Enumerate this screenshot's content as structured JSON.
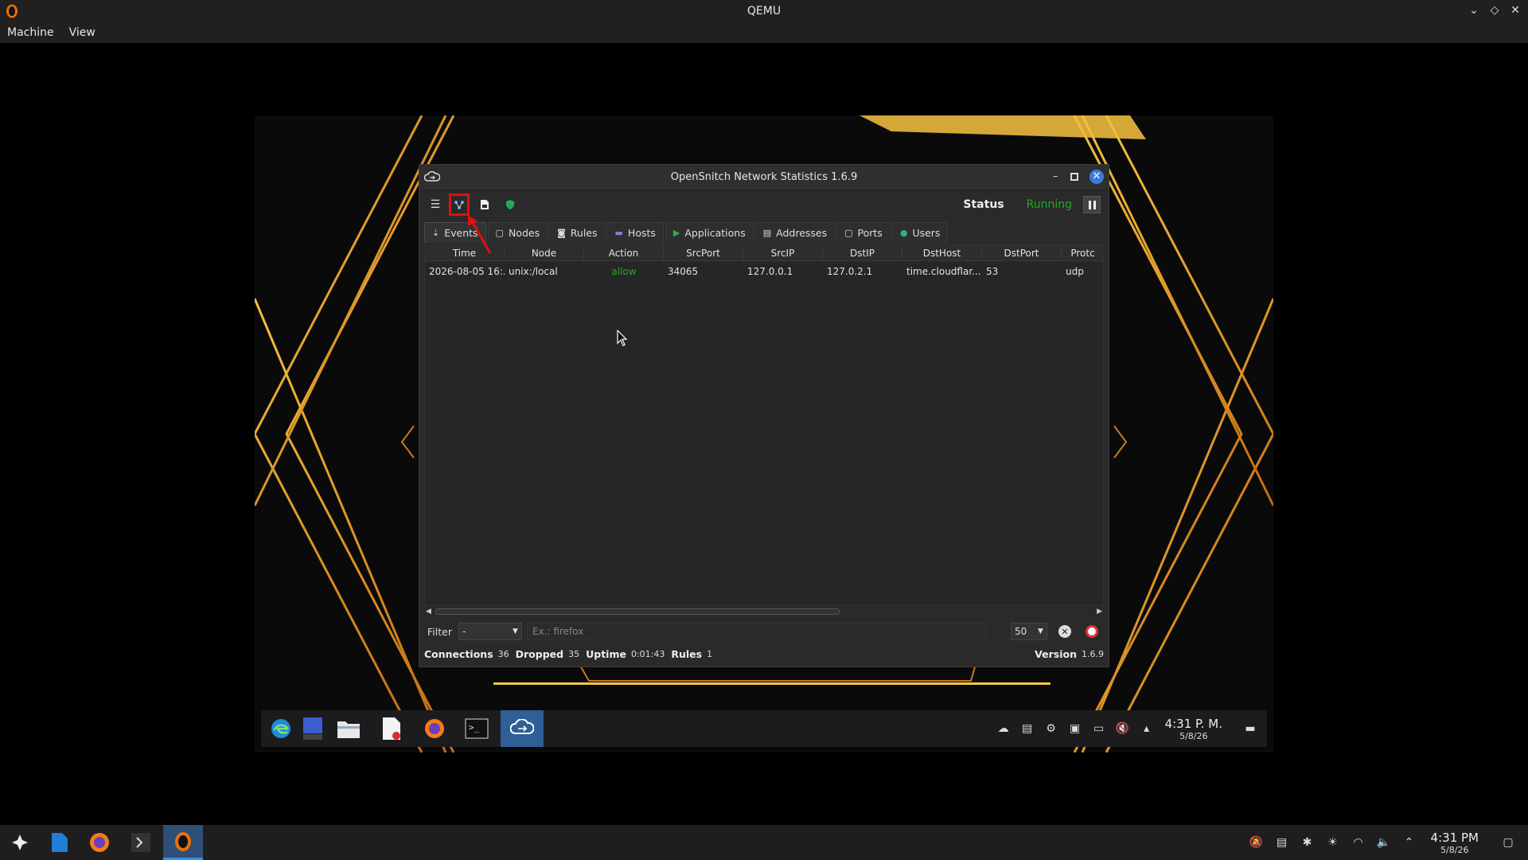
{
  "host": {
    "title": "QEMU",
    "menu": [
      "Machine",
      "View"
    ],
    "clock": {
      "time": "4:31 PM",
      "date": "5/8/26"
    }
  },
  "opensnitch": {
    "title": "OpenSnitch Network Statistics 1.6.9",
    "status_label": "Status",
    "status_value": "Running",
    "tabs": [
      {
        "label": "Events",
        "icon": "events-icon"
      },
      {
        "label": "Nodes",
        "icon": "nodes-icon"
      },
      {
        "label": "Rules",
        "icon": "rules-icon"
      },
      {
        "label": "Hosts",
        "icon": "hosts-icon"
      },
      {
        "label": "Applications",
        "icon": "applications-icon"
      },
      {
        "label": "Addresses",
        "icon": "addresses-icon"
      },
      {
        "label": "Ports",
        "icon": "ports-icon"
      },
      {
        "label": "Users",
        "icon": "users-icon"
      }
    ],
    "columns": [
      "Time",
      "Node",
      "Action",
      "SrcPort",
      "SrcIP",
      "DstIP",
      "DstHost",
      "DstPort",
      "Protc"
    ],
    "rows": [
      [
        "2026-08-05 16:...",
        "unix:/local",
        "allow",
        "34065",
        "127.0.0.1",
        "127.0.2.1",
        "time.cloudflar...",
        "53",
        "udp"
      ]
    ],
    "filter": {
      "label": "Filter",
      "select_value": "-",
      "placeholder": "Ex.: firefox",
      "limit": "50"
    },
    "statusbar": {
      "connections_label": "Connections",
      "connections": "36",
      "dropped_label": "Dropped",
      "dropped": "35",
      "uptime_label": "Uptime",
      "uptime": "0:01:43",
      "rules_label": "Rules",
      "rules": "1",
      "version_label": "Version",
      "version": "1.6.9"
    }
  },
  "guest": {
    "clock": {
      "time": "4:31 P. M.",
      "date": "5/8/26"
    }
  },
  "colors": {
    "running": "#22aa22",
    "highlight": "#e01010",
    "accent": "#3d7bdb"
  }
}
